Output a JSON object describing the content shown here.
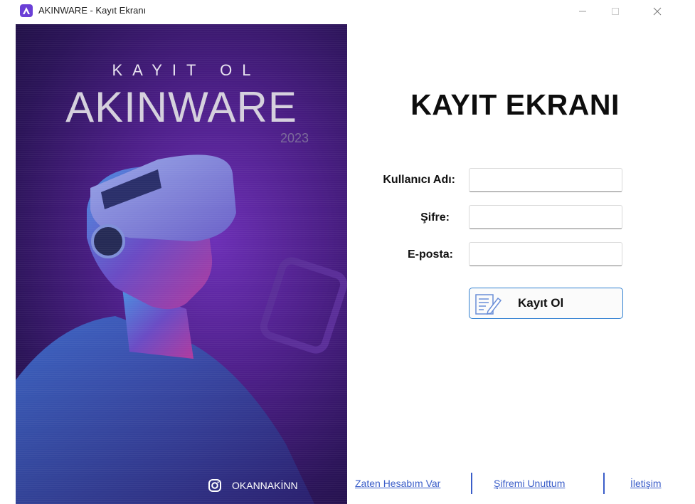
{
  "window": {
    "title": "AKINWARE - Kayıt Ekranı",
    "icon": "app-logo-icon",
    "controls": [
      "minimize-icon",
      "maximize-icon",
      "close-icon"
    ]
  },
  "banner": {
    "subtitle": "KAYIT OL",
    "title": "AKINWARE",
    "year": "2023",
    "social_icon": "instagram-icon",
    "social_handle": "OKANNAKİNN"
  },
  "form": {
    "heading": "KAYIT EKRANI",
    "username_label": "Kullanıcı Adı:",
    "username_value": "",
    "password_label": "Şifre:",
    "password_value": "",
    "email_label": "E-posta:",
    "email_value": "",
    "submit_label": "Kayıt Ol",
    "submit_icon": "form-edit-icon"
  },
  "footer": {
    "links": [
      "Zaten Hesabım Var",
      "Şifremi Unuttum",
      "İletişim"
    ]
  },
  "colors": {
    "accent": "#2f7fd1",
    "link": "#3b5ec9",
    "banner_dark": "#2b1458",
    "banner_light": "#6c2fb6"
  }
}
